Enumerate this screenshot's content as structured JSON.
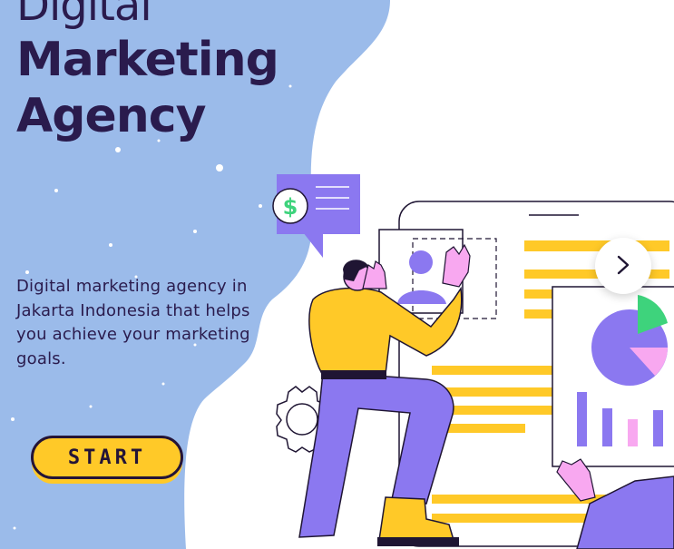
{
  "hero": {
    "title_line1": "Digital",
    "title_line2": "Marketing",
    "title_line3": "Agency",
    "description": "Digital marketing agency in Jakarta Indonesia that helps you achieve your marketing goals.",
    "start_label": "START"
  },
  "carousel": {
    "next_icon": "chevron-right-icon"
  },
  "illustration": {
    "icons": [
      "dollar-icon",
      "gear-icon",
      "pie-chart-icon",
      "bar-chart-icon",
      "person-figure"
    ]
  },
  "colors": {
    "background_blue": "#9bbbea",
    "title_navy": "#2a1b4d",
    "accent_yellow": "#ffc928",
    "accent_purple": "#8b78f0",
    "accent_green": "#3ed37c",
    "accent_pink": "#f8a8f0"
  }
}
